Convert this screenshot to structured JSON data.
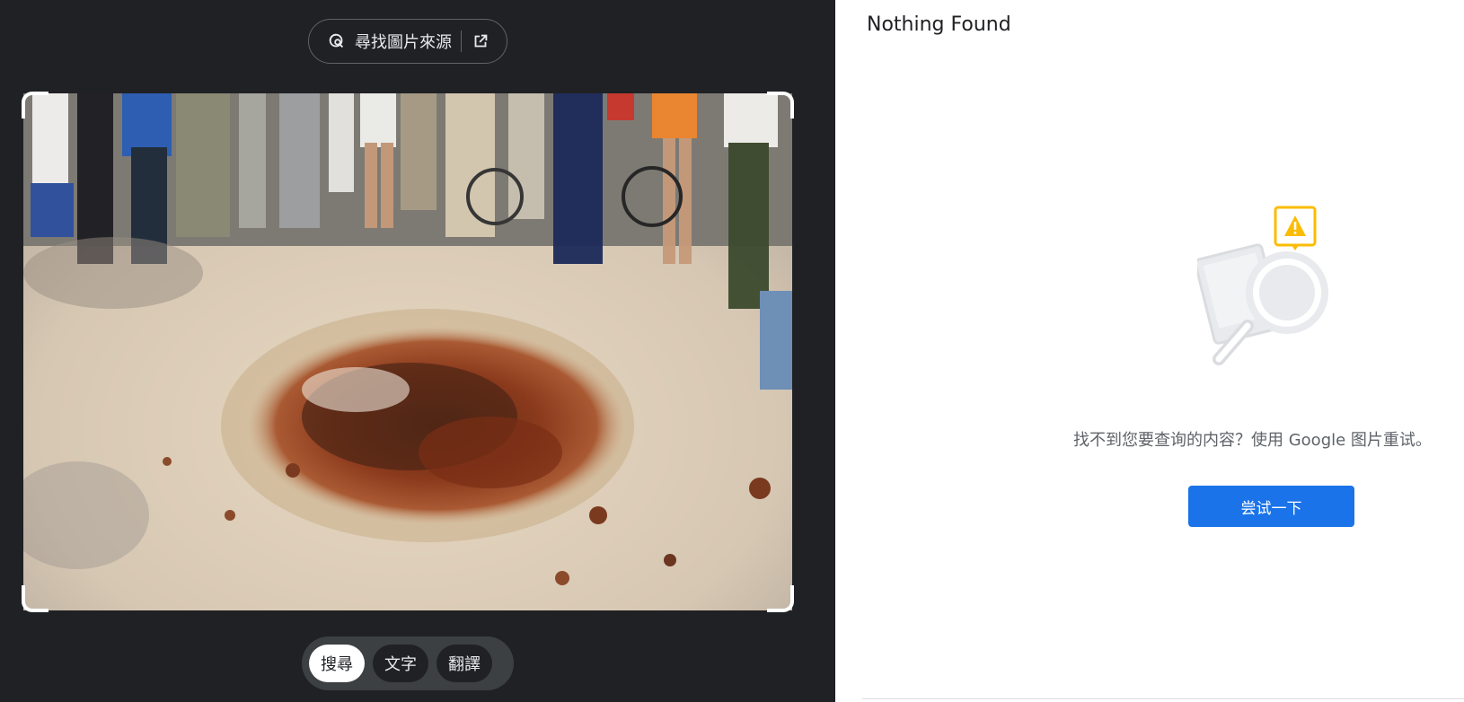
{
  "left_panel": {
    "source_button": {
      "label": "尋找圖片來源",
      "lens_icon": "google-lens-icon",
      "open_icon": "open-in-new-icon"
    },
    "photo": {
      "description_icon": "uploaded-photo"
    },
    "modes": [
      {
        "label": "搜尋",
        "active": true
      },
      {
        "label": "文字",
        "active": false
      },
      {
        "label": "翻譯",
        "active": false
      }
    ]
  },
  "right_panel": {
    "title": "Nothing Found",
    "illustration_icon": "no-results-magnifier-warning-icon",
    "message": "找不到您要查询的内容？使用 Google 图片重试。",
    "try_button_label": "尝试一下"
  },
  "colors": {
    "dark_bg": "#202124",
    "accent_blue": "#1a73e8",
    "warning_yellow": "#fbbc04"
  }
}
